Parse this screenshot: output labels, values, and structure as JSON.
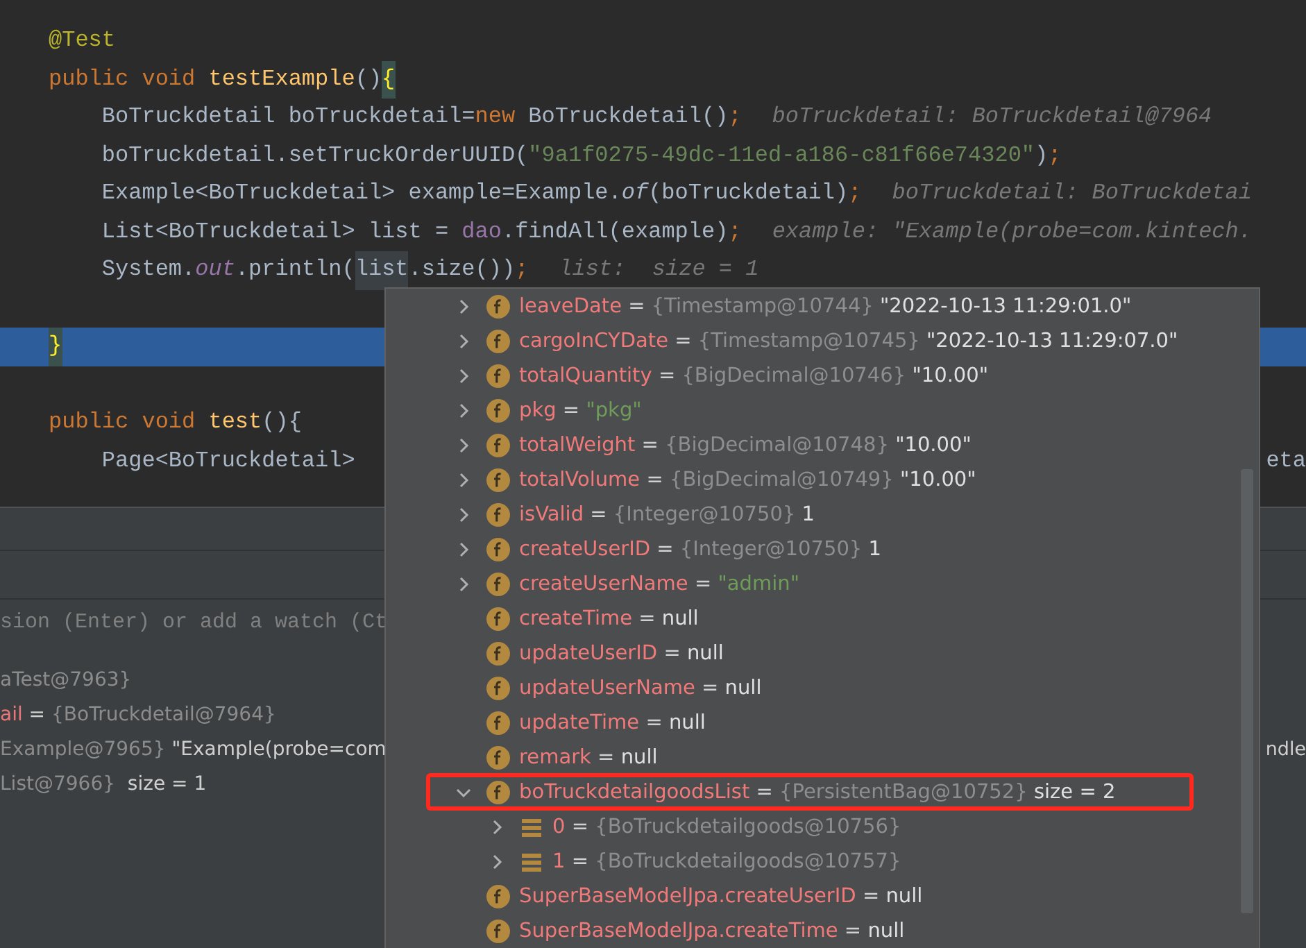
{
  "editor": {
    "lines": [
      {
        "highlighted": false,
        "segments": [
          {
            "text": "@Test",
            "kind": "annotation"
          }
        ]
      },
      {
        "highlighted": false,
        "segments": [
          {
            "text": "public void ",
            "kind": "keyword"
          },
          {
            "text": "testExample",
            "kind": "method"
          },
          {
            "text": "()",
            "kind": "plain"
          },
          {
            "text": "{",
            "kind": "brace-match"
          }
        ]
      },
      {
        "highlighted": false,
        "segments": [
          {
            "text": "    BoTruckdetail boTruckdetail=",
            "kind": "plain"
          },
          {
            "text": "new ",
            "kind": "keyword"
          },
          {
            "text": "BoTruckdetail()",
            "kind": "plain"
          },
          {
            "text": ";",
            "kind": "keyword"
          },
          {
            "text": "boTruckdetail: BoTruckdetail@7964",
            "kind": "hint"
          }
        ]
      },
      {
        "highlighted": false,
        "segments": [
          {
            "text": "    boTruckdetail.setTruckOrderUUID(",
            "kind": "plain"
          },
          {
            "text": "\"9a1f0275-49dc-11ed-a186-c81f66e74320\"",
            "kind": "string"
          },
          {
            "text": ")",
            "kind": "plain"
          },
          {
            "text": ";",
            "kind": "keyword"
          }
        ]
      },
      {
        "highlighted": false,
        "segments": [
          {
            "text": "    Example<BoTruckdetail> example=Example.",
            "kind": "plain"
          },
          {
            "text": "of",
            "kind": "italic"
          },
          {
            "text": "(boTruckdetail)",
            "kind": "plain"
          },
          {
            "text": ";",
            "kind": "keyword"
          },
          {
            "text": "boTruckdetail: BoTruckdetai",
            "kind": "hint"
          }
        ]
      },
      {
        "highlighted": false,
        "segments": [
          {
            "text": "    List<BoTruckdetail> list = ",
            "kind": "plain"
          },
          {
            "text": "dao",
            "kind": "field"
          },
          {
            "text": ".findAll(example)",
            "kind": "plain"
          },
          {
            "text": ";",
            "kind": "keyword"
          },
          {
            "text": "example: \"Example(probe=com.kintech.",
            "kind": "hint"
          }
        ]
      },
      {
        "highlighted": false,
        "segments": [
          {
            "text": "    System.",
            "kind": "plain"
          },
          {
            "text": "out",
            "kind": "static"
          },
          {
            "text": ".println(",
            "kind": "plain"
          },
          {
            "text": "list",
            "kind": "usage"
          },
          {
            "text": ".size())",
            "kind": "plain"
          },
          {
            "text": ";",
            "kind": "keyword"
          },
          {
            "text": "list:  size = 1",
            "kind": "hint"
          }
        ]
      },
      {
        "highlighted": false
      },
      {
        "highlighted": true,
        "segments": [
          {
            "text": "}",
            "kind": "brace-match"
          }
        ]
      },
      {
        "highlighted": false
      },
      {
        "highlighted": false,
        "segments": [
          {
            "text": "public void ",
            "kind": "keyword"
          },
          {
            "text": "test",
            "kind": "method"
          },
          {
            "text": "(){",
            "kind": "plain"
          }
        ]
      },
      {
        "highlighted": false,
        "segments": [
          {
            "text": "    Page<BoTruckdetail>",
            "kind": "plain"
          }
        ],
        "tail": "eta"
      }
    ]
  },
  "debugger": {
    "watch_placeholder": "sion (Enter) or add a watch (Ct",
    "variables": [
      {
        "segments": [
          {
            "text": "aTest@7963}",
            "kind": "type"
          }
        ]
      },
      {
        "segments": [
          {
            "text": "ail",
            "kind": "name"
          },
          {
            "text": " = ",
            "kind": "plain"
          },
          {
            "text": "{BoTruckdetail@7964}",
            "kind": "type"
          }
        ]
      },
      {
        "segments": [
          {
            "text": "Example@7965} ",
            "kind": "type"
          },
          {
            "text": "\"Example(probe=com",
            "kind": "plain"
          }
        ],
        "tail": "ndle"
      },
      {
        "segments": [
          {
            "text": "List@7966} ",
            "kind": "type"
          },
          {
            "text": " size = 1",
            "kind": "plain"
          }
        ]
      }
    ]
  },
  "popup": {
    "rows": [
      {
        "kind": "field",
        "name": "leaveDate",
        "operator": "=",
        "expanded": false,
        "type": "{Timestamp@10744}",
        "value": {
          "text": "\"2022-10-13 11:29:01.0\"",
          "kind": "plain"
        }
      },
      {
        "kind": "field",
        "name": "cargoInCYDate",
        "operator": "=",
        "expanded": false,
        "type": "{Timestamp@10745}",
        "value": {
          "text": "\"2022-10-13 11:29:07.0\"",
          "kind": "plain"
        }
      },
      {
        "kind": "field",
        "name": "totalQuantity",
        "operator": "=",
        "expanded": false,
        "type": "{BigDecimal@10746}",
        "value": {
          "text": "\"10.00\"",
          "kind": "plain"
        }
      },
      {
        "kind": "field",
        "name": "pkg",
        "operator": "=",
        "expanded": false,
        "value": {
          "text": "\"pkg\"",
          "kind": "string"
        }
      },
      {
        "kind": "field",
        "name": "totalWeight",
        "operator": "=",
        "expanded": false,
        "type": "{BigDecimal@10748}",
        "value": {
          "text": "\"10.00\"",
          "kind": "plain"
        }
      },
      {
        "kind": "field",
        "name": "totalVolume",
        "operator": "=",
        "expanded": false,
        "type": "{BigDecimal@10749}",
        "value": {
          "text": "\"10.00\"",
          "kind": "plain"
        }
      },
      {
        "kind": "field",
        "name": "isValid",
        "operator": "=",
        "expanded": false,
        "type": "{Integer@10750}",
        "value": {
          "text": "1",
          "kind": "plain"
        }
      },
      {
        "kind": "field",
        "name": "createUserID",
        "operator": "=",
        "expanded": false,
        "type": "{Integer@10750}",
        "value": {
          "text": "1",
          "kind": "plain"
        }
      },
      {
        "kind": "field",
        "name": "createUserName",
        "operator": "=",
        "expanded": false,
        "value": {
          "text": "\"admin\"",
          "kind": "string"
        }
      },
      {
        "kind": "field",
        "name": "createTime",
        "operator": "=",
        "value": {
          "text": "null",
          "kind": "plain"
        }
      },
      {
        "kind": "field",
        "name": "updateUserID",
        "operator": "=",
        "value": {
          "text": "null",
          "kind": "plain"
        }
      },
      {
        "kind": "field",
        "name": "updateUserName",
        "operator": "=",
        "value": {
          "text": "null",
          "kind": "plain"
        }
      },
      {
        "kind": "field",
        "name": "updateTime",
        "operator": "=",
        "value": {
          "text": "null",
          "kind": "plain"
        }
      },
      {
        "kind": "field",
        "name": "remark",
        "operator": "=",
        "value": {
          "text": "null",
          "kind": "plain"
        }
      },
      {
        "kind": "field",
        "name": "boTruckdetailgoodsList",
        "operator": "=",
        "expanded": true,
        "marked": true,
        "type": "{PersistentBag@10752}",
        "value": {
          "text": "size = 2",
          "kind": "plain"
        },
        "children": [
          {
            "kind": "element",
            "name": "0",
            "operator": "=",
            "expanded": false,
            "type": "{BoTruckdetailgoods@10756}"
          },
          {
            "kind": "element",
            "name": "1",
            "operator": "=",
            "expanded": false,
            "type": "{BoTruckdetailgoods@10757}"
          }
        ]
      },
      {
        "kind": "field",
        "name": "SuperBaseModelJpa.createUserID",
        "operator": "=",
        "value": {
          "text": "null",
          "kind": "plain"
        }
      },
      {
        "kind": "field",
        "name": "SuperBaseModelJpa.createTime",
        "operator": "=",
        "value": {
          "text": "null",
          "kind": "plain"
        }
      }
    ]
  }
}
